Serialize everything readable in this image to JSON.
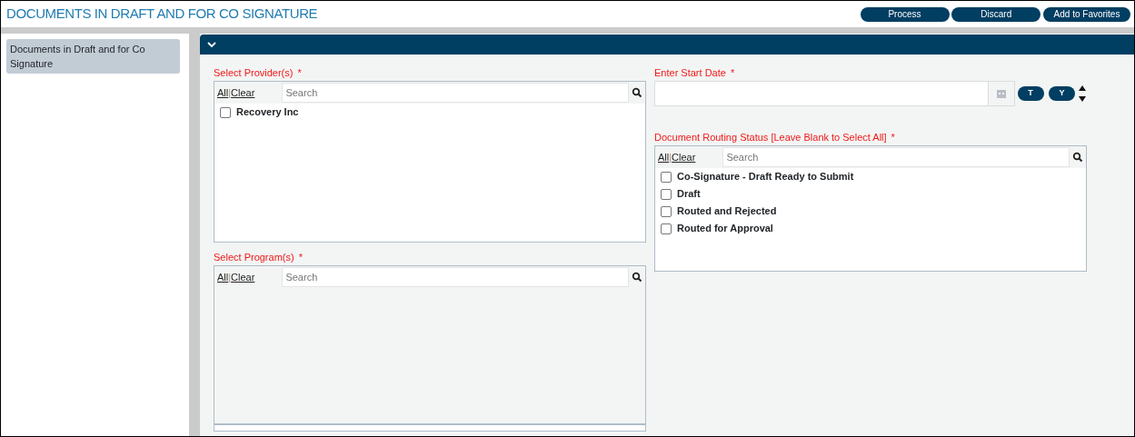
{
  "window": {
    "title": "DOCUMENTS IN DRAFT AND FOR CO SIGNATURE"
  },
  "buttons": [
    "Process",
    "Discard",
    "Add to Favorites"
  ],
  "sidebar": {
    "items": [
      {
        "label": "Documents in Draft and for Co Signature",
        "selected": true
      }
    ]
  },
  "form": {
    "expanded": true,
    "providers": {
      "label": "Select Provider(s)",
      "required": "*",
      "all": "All",
      "separator": "|",
      "clear": "Clear",
      "placeholder": "Search",
      "options": [
        {
          "label": "Recovery Inc",
          "checked": false
        }
      ]
    },
    "programs": {
      "label": "Select Program(s)",
      "required": "*",
      "all": "All",
      "separator": "|",
      "clear": "Clear",
      "placeholder": "Search"
    },
    "start_date": {
      "label": "Enter Start Date",
      "required": "*",
      "today": "T",
      "yesterday": "Y"
    },
    "routing_status": {
      "label": "Document Routing Status [Leave Blank to Select All]",
      "required": "*",
      "all": "All",
      "separator": "|",
      "clear": "Clear",
      "placeholder": "Search",
      "options": [
        {
          "label": "Co-Signature - Draft Ready to Submit",
          "checked": false
        },
        {
          "label": "Draft",
          "checked": false
        },
        {
          "label": "Routed and Rejected",
          "checked": false
        },
        {
          "label": "Routed for Approval",
          "checked": false
        }
      ]
    }
  }
}
